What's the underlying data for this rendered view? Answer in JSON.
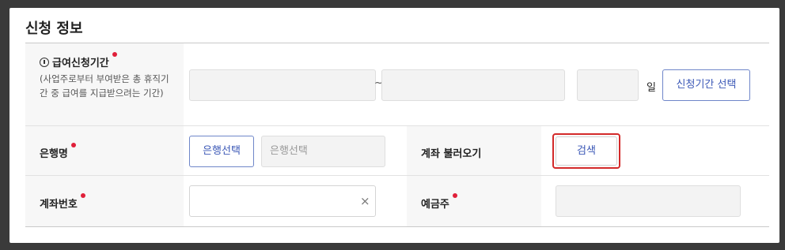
{
  "section_title": "신청 정보",
  "period": {
    "label": "급여신청기간",
    "required_icon": "required-dot",
    "description": "(사업주로부터 부여받은 총 휴직기간 중 급여를 지급받으려는 기간)",
    "start_value": "",
    "end_value": "",
    "separator": "~",
    "days_value": "",
    "days_unit": "일",
    "select_button": "신청기간 선택"
  },
  "bank": {
    "label": "은행명",
    "select_button": "은행선택",
    "selected_placeholder": "은행선택"
  },
  "account_load": {
    "label": "계좌 불러오기",
    "search_button": "검색"
  },
  "account_number": {
    "label": "계좌번호",
    "value": "",
    "clear_icon": "close-icon",
    "clear_glyph": "×"
  },
  "depositor": {
    "label": "예금주",
    "value": ""
  },
  "colors": {
    "accent": "#3a57b6",
    "required": "#e0203a",
    "highlight": "#d32a2a"
  }
}
